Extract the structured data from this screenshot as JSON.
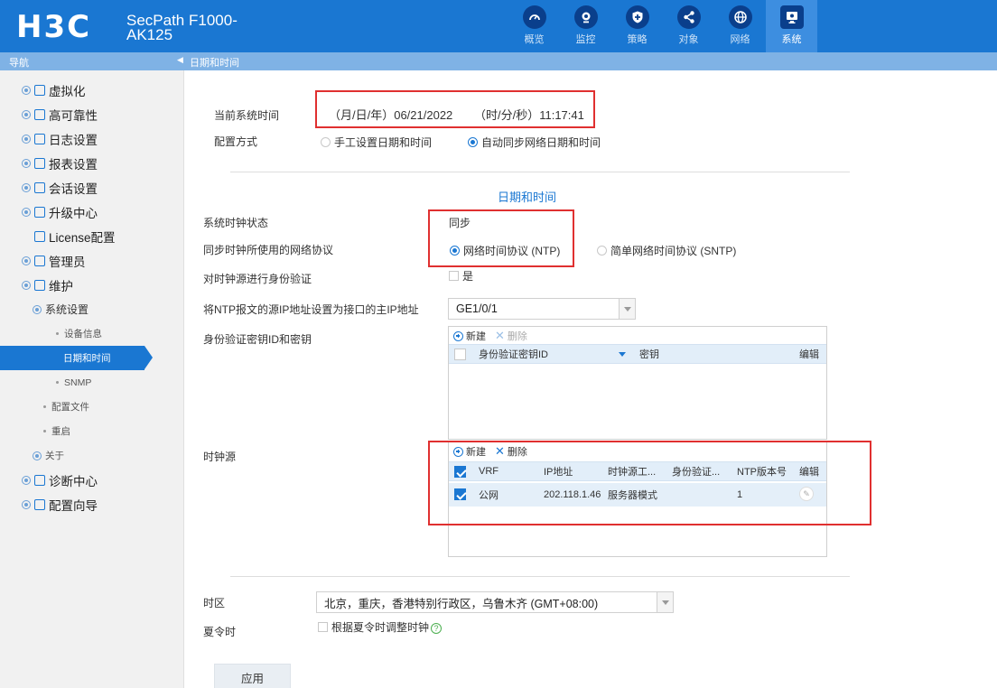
{
  "header": {
    "logo": "H3C",
    "product_line1": "SecPath F1000-",
    "product_line2": "AK125",
    "tabs": [
      {
        "label": "概览",
        "icon": "gauge-icon"
      },
      {
        "label": "监控",
        "icon": "monitor-icon"
      },
      {
        "label": "策略",
        "icon": "shield-icon"
      },
      {
        "label": "对象",
        "icon": "share-icon"
      },
      {
        "label": "网络",
        "icon": "globe-icon"
      },
      {
        "label": "系统",
        "icon": "screen-icon"
      }
    ]
  },
  "topbar": {
    "nav_label": "导航",
    "collapse": "◀",
    "breadcrumb": "日期和时间"
  },
  "sidebar": {
    "items": [
      {
        "label": "虚拟化"
      },
      {
        "label": "高可靠性"
      },
      {
        "label": "日志设置"
      },
      {
        "label": "报表设置"
      },
      {
        "label": "会话设置"
      },
      {
        "label": "升级中心"
      },
      {
        "label": "License配置"
      },
      {
        "label": "管理员"
      },
      {
        "label": "维护"
      },
      {
        "label": "系统设置"
      },
      {
        "label": "设备信息"
      },
      {
        "label": "日期和时间"
      },
      {
        "label": "SNMP"
      },
      {
        "label": "配置文件"
      },
      {
        "label": "重启"
      },
      {
        "label": "关于"
      },
      {
        "label": "诊断中心"
      },
      {
        "label": "配置向导"
      }
    ]
  },
  "main": {
    "current_time_label": "当前系统时间",
    "date_label": "（月/日/年）06/21/2022",
    "time_label": "（时/分/秒）11:17:41",
    "config_mode_label": "配置方式",
    "manual_option": "手工设置日期和时间",
    "auto_option": "自动同步网络日期和时间",
    "section_title": "日期和时间",
    "clock_status_label": "系统时钟状态",
    "clock_status_value": "同步",
    "protocol_label": "同步时钟所使用的网络协议",
    "ntp_option": "网络时间协议 (NTP)",
    "sntp_option": "简单网络时间协议 (SNTP)",
    "auth_label": "对时钟源进行身份验证",
    "auth_yes": "是",
    "src_ip_label": "将NTP报文的源IP地址设置为接口的主IP地址",
    "src_ip_value": "GE1/0/1",
    "key_label": "身份验证密钥ID和密钥",
    "key_grid": {
      "new": "新建",
      "delete": "删除",
      "col_id": "身份验证密钥ID",
      "col_key": "密钥",
      "col_edit": "编辑"
    },
    "clock_source_label": "时钟源",
    "src_grid": {
      "new": "新建",
      "delete": "删除",
      "headers": [
        "VRF",
        "IP地址",
        "时钟源工...",
        "身份验证...",
        "NTP版本号",
        "编辑"
      ],
      "rows": [
        {
          "vrf": "公网",
          "ip": "202.118.1.46",
          "mode": "服务器模式",
          "auth": "",
          "version": "1"
        }
      ]
    },
    "timezone_label": "时区",
    "timezone_value": "北京，重庆，香港特别行政区，乌鲁木齐 (GMT+08:00)",
    "dst_label": "夏令时",
    "dst_option": "根据夏令时调整时钟",
    "help_icon": "?",
    "apply_button": "应用"
  },
  "colors": {
    "header": "#1a77d2",
    "highlight_box": "#e03030",
    "accent": "#1a77d2"
  }
}
